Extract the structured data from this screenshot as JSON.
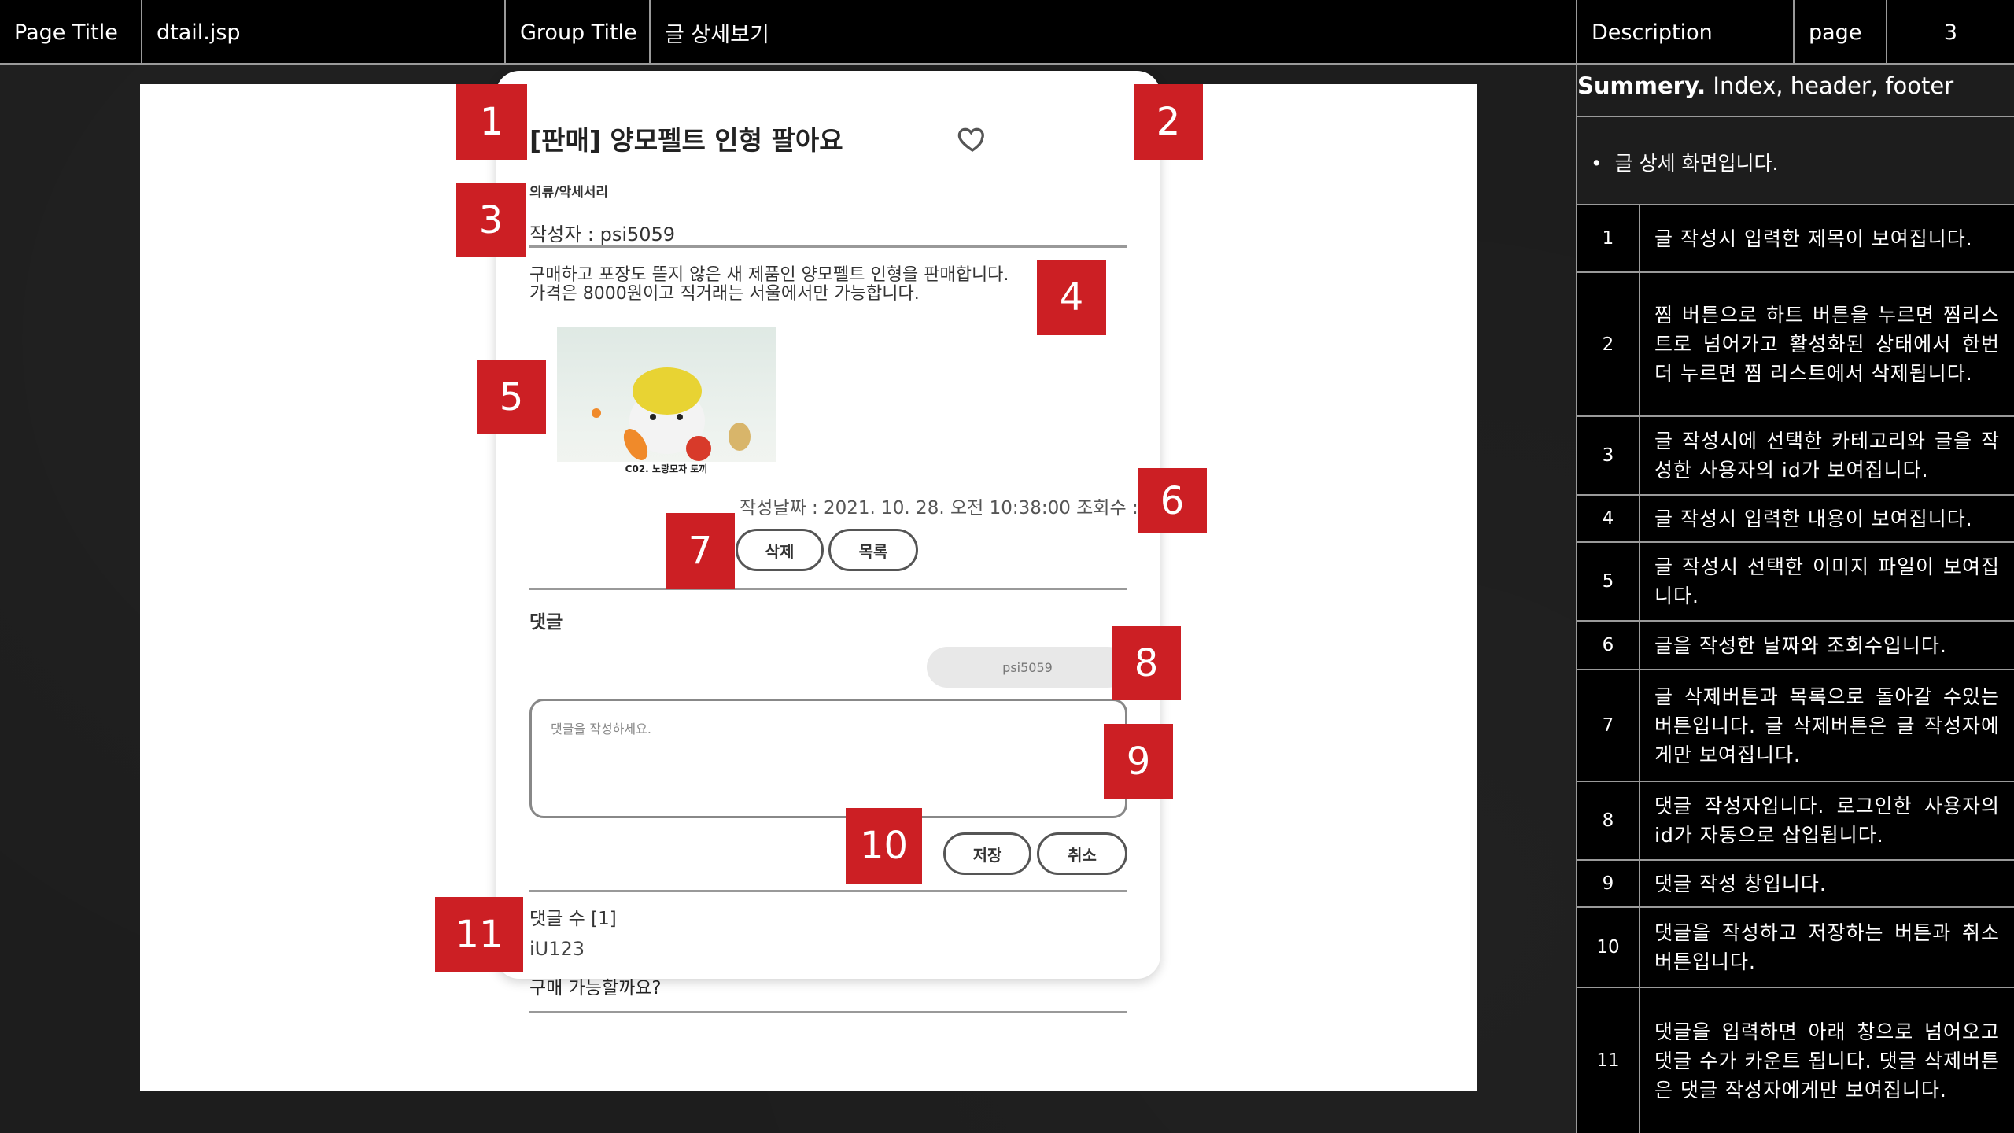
{
  "header": {
    "page_title_label": "Page Title",
    "page_title_value": "dtail.jsp",
    "group_title_label": "Group Title",
    "group_title_value": "글 상세보기",
    "description_label": "Description",
    "page_label": "page",
    "page_number": "3"
  },
  "mockup": {
    "title": "[판매] 양모펠트 인형 팔아요",
    "category": "의류/악세서리",
    "author": "작성자 : psi5059",
    "body_line1": "구매하고 포장도 뜯지 않은 새 제품인 양모펠트 인형을 판매합니다.",
    "body_line2": "가격은 8000원이고 직거래는 서울에서만 가능합니다.",
    "image_caption": "C02. 노랑모자 토끼",
    "meta": "작성날짜 : 2021. 10. 28. 오전 10:38:00   조회수 : 2",
    "delete_button": "삭제",
    "list_button": "목록",
    "comment_heading": "댓글",
    "comment_writer": "psi5059",
    "comment_placeholder": "댓글을 작성하세요.",
    "save_button": "저장",
    "cancel_button": "취소",
    "comment_count": "댓글 수 [1]",
    "comment_user": "iU123",
    "comment_text": "구매 가능할까요?"
  },
  "markers": [
    "1",
    "2",
    "3",
    "4",
    "5",
    "6",
    "7",
    "8",
    "9",
    "10",
    "11"
  ],
  "panel": {
    "summary_bold": "Summery.",
    "summary_rest": " Index, header, footer",
    "bullet": "글 상세 화면입니다.",
    "rows": [
      {
        "num": "1",
        "text": "글 작성시 입력한 제목이 보여집니다."
      },
      {
        "num": "2",
        "text": "찜 버튼으로 하트 버튼을 누르면 찜리스트로 넘어가고 활성화된 상태에서 한번 더 누르면 찜 리스트에서 삭제됩니다."
      },
      {
        "num": "3",
        "text": "글 작성시에 선택한 카테고리와 글을 작성한 사용자의 id가 보여집니다."
      },
      {
        "num": "4",
        "text": "글 작성시 입력한 내용이 보여집니다."
      },
      {
        "num": "5",
        "text": "글 작성시 선택한 이미지 파일이 보여집니다."
      },
      {
        "num": "6",
        "text": "글을 작성한 날짜와 조회수입니다."
      },
      {
        "num": "7",
        "text": "글 삭제버튼과 목록으로 돌아갈 수있는 버튼입니다. 글 삭제버튼은 글 작성자에게만 보여집니다."
      },
      {
        "num": "8",
        "text": "댓글 작성자입니다. 로그인한 사용자의 id가 자동으로 삽입됩니다."
      },
      {
        "num": "9",
        "text": "댓글 작성 창입니다."
      },
      {
        "num": "10",
        "text": "댓글을 작성하고 저장하는 버튼과 취소 버튼입니다."
      },
      {
        "num": "11",
        "text": "댓글을 입력하면 아래 창으로 넘어오고 댓글 수가 카운트 됩니다. 댓글 삭제버튼은 댓글 작성자에게만 보여집니다."
      }
    ]
  }
}
